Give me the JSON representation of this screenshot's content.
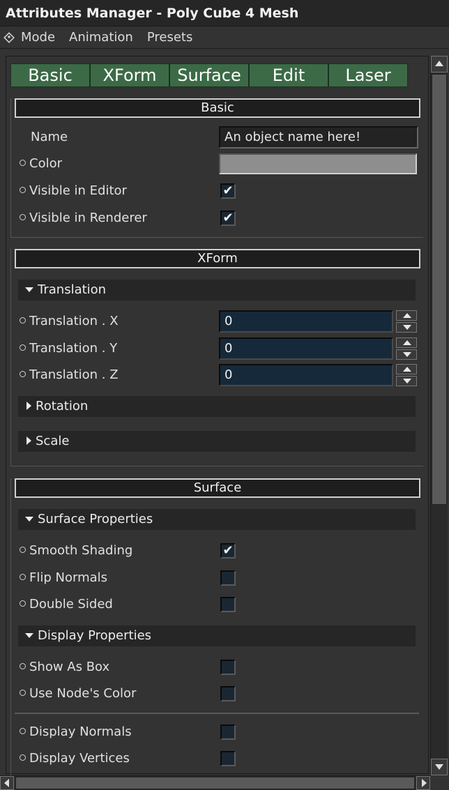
{
  "window": {
    "title": "Attributes Manager - Poly Cube 4 Mesh"
  },
  "menu": {
    "items": [
      "Mode",
      "Animation",
      "Presets"
    ]
  },
  "tabs": [
    "Basic",
    "XForm",
    "Surface",
    "Edit",
    "Laser"
  ],
  "basic": {
    "header": "Basic",
    "name_label": "Name",
    "name_value": "An object name here!",
    "color_label": "Color",
    "color_value": "#8e8e8e",
    "visible_editor_label": "Visible in Editor",
    "visible_editor": true,
    "visible_renderer_label": "Visible in Renderer",
    "visible_renderer": true
  },
  "xform": {
    "header": "XForm",
    "translation_group": "Translation",
    "tx_label": "Translation . X",
    "tx_value": "0",
    "ty_label": "Translation . Y",
    "ty_value": "0",
    "tz_label": "Translation . Z",
    "tz_value": "0",
    "rotation_group": "Rotation",
    "scale_group": "Scale"
  },
  "surface": {
    "header": "Surface",
    "surface_props_group": "Surface Properties",
    "smooth_label": "Smooth Shading",
    "smooth": true,
    "flip_label": "Flip Normals",
    "flip": false,
    "double_label": "Double Sided",
    "double": false,
    "display_props_group": "Display Properties",
    "box_label": "Show As Box",
    "box": false,
    "nodecolor_label": "Use Node's Color",
    "nodecolor": false,
    "normals_label": "Display Normals",
    "normals": false,
    "vertices_label": "Display Vertices",
    "vertices": false
  },
  "glyphs": {
    "check": "✔"
  },
  "colors": {
    "tab_green": "#3c6a47",
    "numeric_field": "#16293a",
    "background": "#333333"
  }
}
